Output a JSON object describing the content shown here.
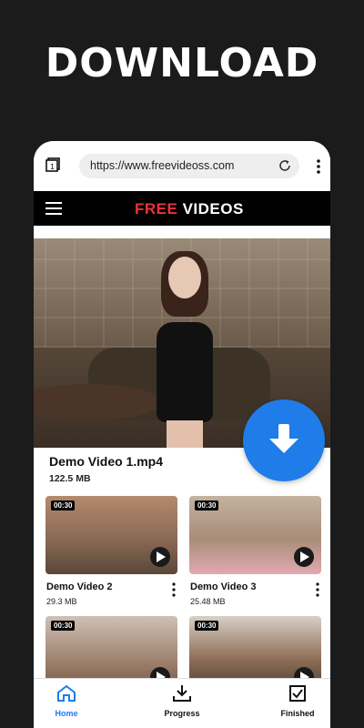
{
  "headline": "DOWNLOAD",
  "browser": {
    "url": "https://www.freevideoss.com"
  },
  "appbar": {
    "brand_free": "FREE",
    "brand_videos": " VIDEOS"
  },
  "hero": {
    "title": "Demo Video 1.mp4",
    "size": "122.5 MB"
  },
  "videos": [
    {
      "name": "Demo Video 2",
      "size": "29.3 MB",
      "duration": "00:30",
      "thumb_color": "#8a6a55"
    },
    {
      "name": "Demo  Video 3",
      "size": "25.48 MB",
      "duration": "00:30",
      "thumb_color": "#a98d78"
    },
    {
      "name": "",
      "size": "",
      "duration": "00:30",
      "thumb_color": "#9c7f6b"
    },
    {
      "name": "",
      "size": "",
      "duration": "00:30",
      "thumb_color": "#7a5a48"
    }
  ],
  "bottom_nav": {
    "home": "Home",
    "progress": "Progress",
    "finished": "Finished"
  },
  "colors": {
    "accent": "#1f7ce8",
    "brand_red": "#e8333a",
    "background": "#1b1b1b"
  },
  "icons": {
    "tabs": "tabs-icon",
    "reload": "reload-icon",
    "menu": "more-vert-icon",
    "hamburger": "hamburger-menu-icon",
    "download": "download-arrow-icon",
    "play": "play-icon",
    "home": "home-icon",
    "progress": "download-tray-icon",
    "finished": "finished-check-icon"
  }
}
